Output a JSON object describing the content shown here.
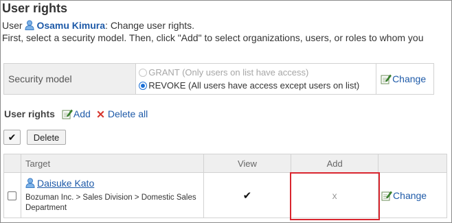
{
  "page": {
    "title": "User rights",
    "intro_prefix": "User",
    "user_name": "Osamu Kimura",
    "intro_suffix": ": Change user rights.",
    "instruction": "First, select a security model. Then, click \"Add\" to select organizations, users, or roles to whom you"
  },
  "security": {
    "label": "Security model",
    "option_grant": "GRANT (Only users on list have access)",
    "option_revoke": "REVOKE (All users have access except users on list)",
    "selected": "REVOKE",
    "change_label": "Change"
  },
  "rights": {
    "label": "User rights",
    "add_label": "Add",
    "delete_all_label": "Delete all",
    "select_all_glyph": "✔",
    "delete_label": "Delete"
  },
  "table": {
    "headers": {
      "target": "Target",
      "view": "View",
      "add": "Add"
    },
    "rows": [
      {
        "name": "Daisuke Kato",
        "org": "Bozuman Inc. > Sales Division > Domestic Sales Department",
        "view": "✔",
        "add": "x",
        "change": "Change"
      }
    ]
  },
  "icons": {
    "person": "person-icon",
    "edit": "edit-icon",
    "delete": "x-icon"
  },
  "colors": {
    "link": "#1e5aa8",
    "highlight": "#d9252e",
    "header_bg": "#efefef"
  }
}
